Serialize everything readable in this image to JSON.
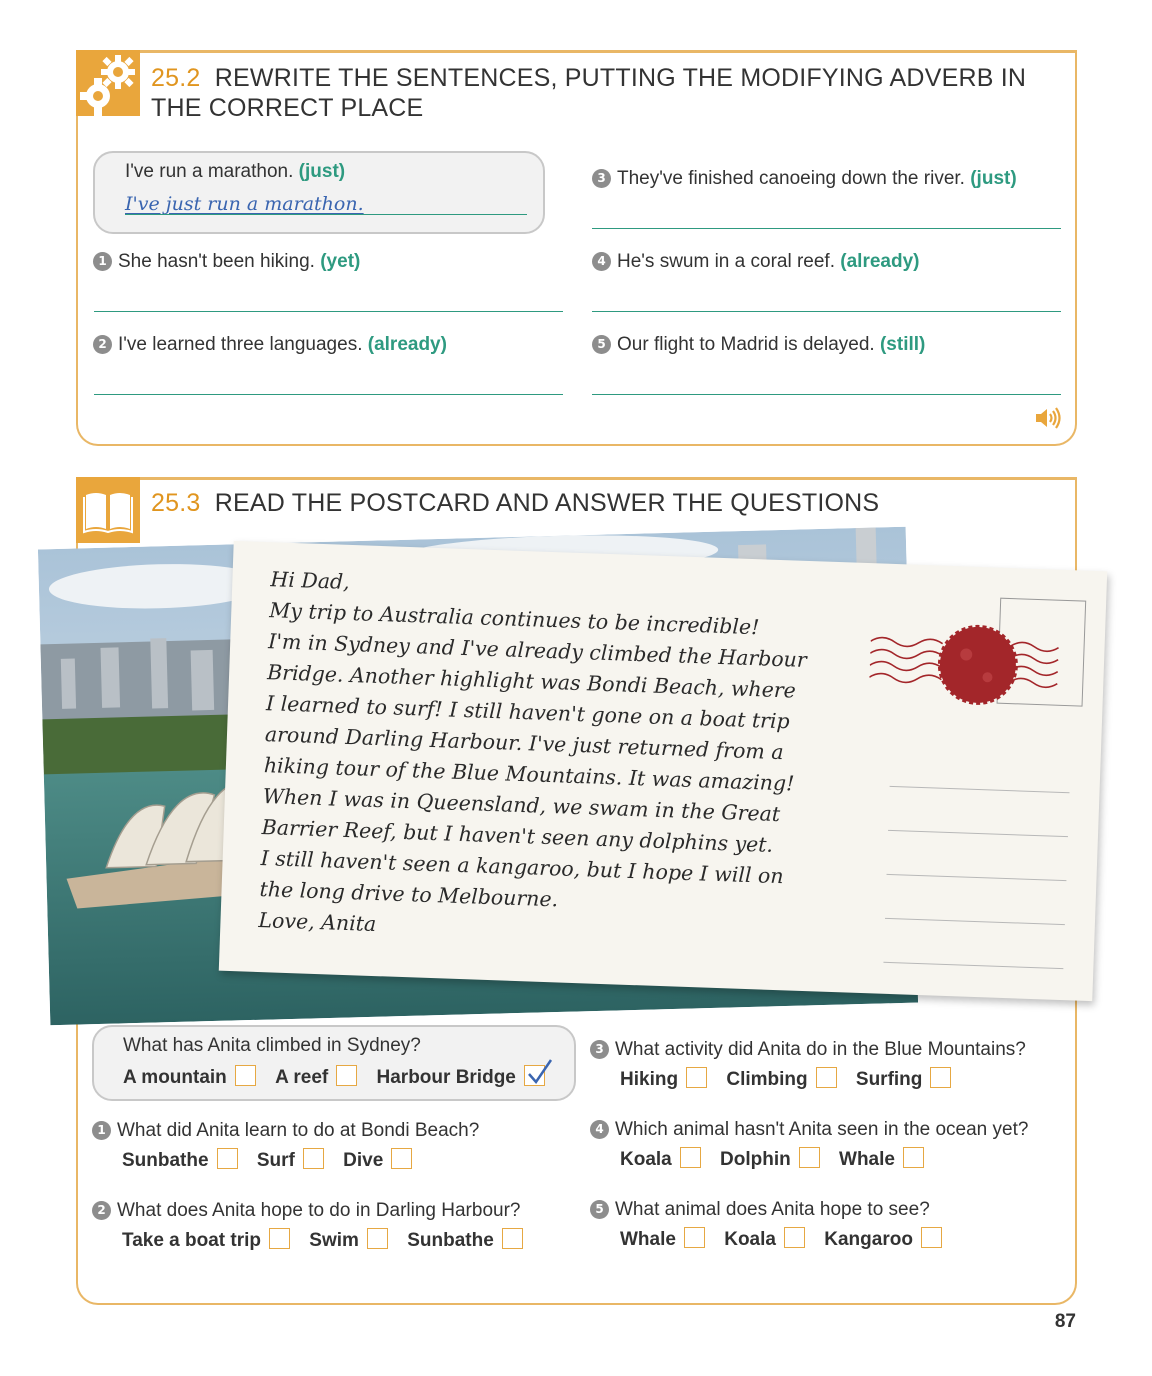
{
  "exercise1": {
    "number": "25.2",
    "title": "REWRITE THE SENTENCES, PUTTING THE MODIFYING ADVERB IN THE CORRECT PLACE",
    "icon": "gear-icon",
    "example": {
      "sentence": "I've run a marathon.",
      "adverb": "(just)",
      "answer": "I've just run a marathon."
    },
    "items": [
      {
        "num": "1",
        "sentence": "She hasn't been hiking.",
        "adverb": "(yet)"
      },
      {
        "num": "2",
        "sentence": "I've learned three languages.",
        "adverb": "(already)"
      },
      {
        "num": "3",
        "sentence": "They've finished canoeing down the river.",
        "adverb": "(just)"
      },
      {
        "num": "4",
        "sentence": "He's swum in a coral reef.",
        "adverb": "(already)"
      },
      {
        "num": "5",
        "sentence": "Our flight to Madrid is delayed.",
        "adverb": "(still)"
      }
    ],
    "audio_icon": "speaker-icon"
  },
  "exercise2": {
    "number": "25.3",
    "title": "READ THE POSTCARD AND ANSWER THE QUESTIONS",
    "icon": "book-icon",
    "postcard": {
      "lines": [
        "Hi Dad,",
        "My trip to Australia continues to be incredible!",
        "I'm in Sydney and I've already climbed the Harbour",
        "Bridge. Another highlight was Bondi Beach, where",
        "I learned to surf! I still haven't gone on a boat trip",
        "around Darling Harbour. I've just returned from a",
        "hiking tour of the Blue Mountains. It was amazing!",
        "When I was in Queensland, we swam in the Great",
        "Barrier Reef, but I haven't seen any dolphins yet.",
        "I still haven't seen a kangaroo, but I hope I will on",
        "the long drive to Melbourne.",
        "Love, Anita"
      ]
    },
    "example": {
      "question": "What has Anita climbed in Sydney?",
      "options": [
        "A mountain",
        "A reef",
        "Harbour Bridge"
      ],
      "checked": 2
    },
    "questions": [
      {
        "num": "1",
        "question": "What did Anita learn to do at Bondi Beach?",
        "options": [
          "Sunbathe",
          "Surf",
          "Dive"
        ]
      },
      {
        "num": "2",
        "question": "What does Anita hope to do in Darling Harbour?",
        "options": [
          "Take a boat trip",
          "Swim",
          "Sunbathe"
        ]
      },
      {
        "num": "3",
        "question": "What activity did Anita do in the Blue Mountains?",
        "options": [
          "Hiking",
          "Climbing",
          "Surfing"
        ]
      },
      {
        "num": "4",
        "question": "Which animal hasn't Anita seen in the ocean yet?",
        "options": [
          "Koala",
          "Dolphin",
          "Whale"
        ]
      },
      {
        "num": "5",
        "question": "What animal does Anita hope to see?",
        "options": [
          "Whale",
          "Koala",
          "Kangaroo"
        ]
      }
    ]
  },
  "page_number": "87",
  "colors": {
    "accent": "#e9a63c",
    "border": "#e9b766",
    "green": "#2e9a80",
    "stamp": "#a3262a"
  }
}
